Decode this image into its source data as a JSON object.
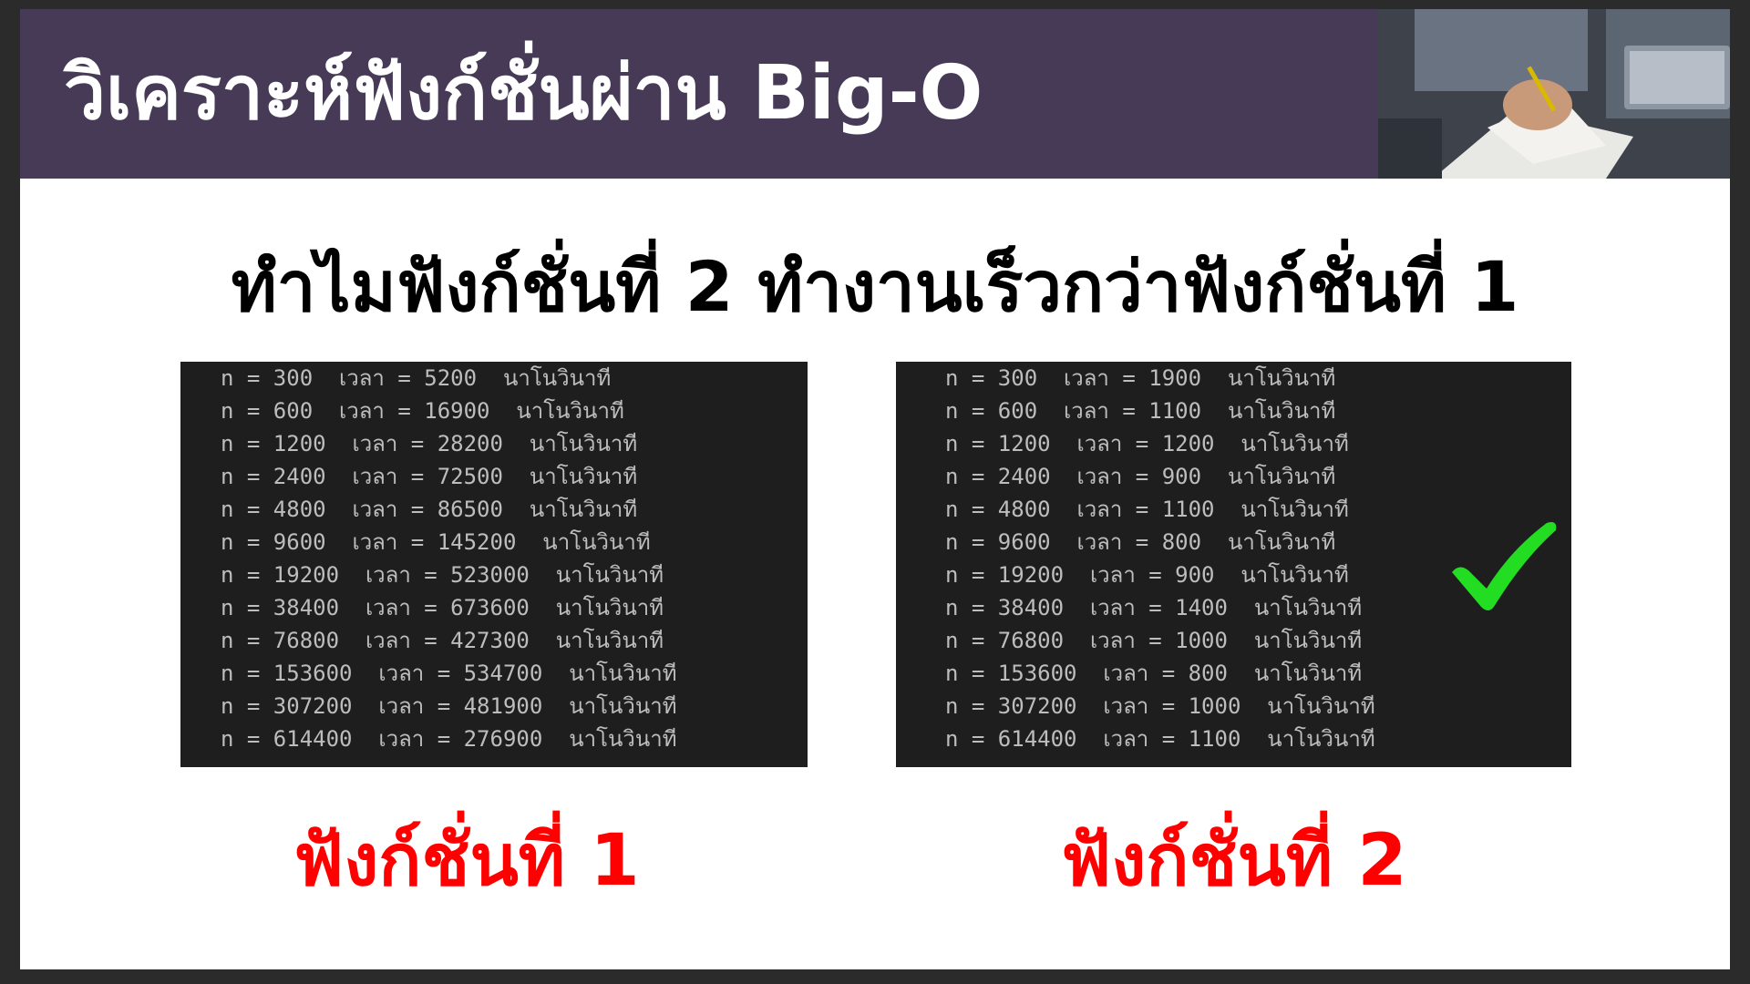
{
  "header": {
    "title": "วิเคราะห์ฟังก์ชั่นผ่าน Big-O"
  },
  "headline": "ทำไมฟังก์ชั่นที่ 2 ทำงานเร็วกว่าฟังก์ชั่นที่ 1",
  "function1": {
    "caption": "ฟังก์ชั่นที่ 1",
    "lines": [
      "n = 300  เวลา = 5200  นาโนวินาที",
      "n = 600  เวลา = 16900  นาโนวินาที",
      "n = 1200  เวลา = 28200  นาโนวินาที",
      "n = 2400  เวลา = 72500  นาโนวินาที",
      "n = 4800  เวลา = 86500  นาโนวินาที",
      "n = 9600  เวลา = 145200  นาโนวินาที",
      "n = 19200  เวลา = 523000  นาโนวินาที",
      "n = 38400  เวลา = 673600  นาโนวินาที",
      "n = 76800  เวลา = 427300  นาโนวินาที",
      "n = 153600  เวลา = 534700  นาโนวินาที",
      "n = 307200  เวลา = 481900  นาโนวินาที",
      "n = 614400  เวลา = 276900  นาโนวินาที"
    ]
  },
  "function2": {
    "caption": "ฟังก์ชั่นที่ 2",
    "lines": [
      "n = 300  เวลา = 1900  นาโนวินาที",
      "n = 600  เวลา = 1100  นาโนวินาที",
      "n = 1200  เวลา = 1200  นาโนวินาที",
      "n = 2400  เวลา = 900  นาโนวินาที",
      "n = 4800  เวลา = 1100  นาโนวินาที",
      "n = 9600  เวลา = 800  นาโนวินาที",
      "n = 19200  เวลา = 900  นาโนวินาที",
      "n = 38400  เวลา = 1400  นาโนวินาที",
      "n = 76800  เวลา = 1000  นาโนวินาที",
      "n = 153600  เวลา = 800  นาโนวินาที",
      "n = 307200  เวลา = 1000  นาโนวินาที",
      "n = 614400  เวลา = 1100  นาโนวินาที"
    ]
  },
  "icons": {
    "checkmark": "checkmark-icon",
    "photo": "person-writing-photo"
  },
  "colors": {
    "header_bg": "#463a56",
    "caption": "#ff0000",
    "checkmark": "#22dd22",
    "console_bg": "#1e1e1e",
    "console_text": "#bdbdbd"
  }
}
